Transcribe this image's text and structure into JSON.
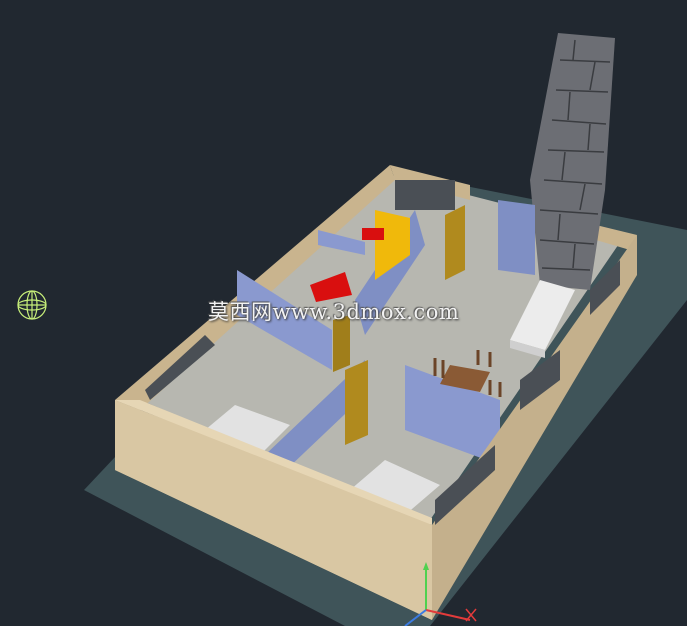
{
  "viewport": {
    "background": "#212830",
    "watermark": "莫西网www.3dmox.com"
  },
  "scene": {
    "subject": "3D house floor plan model",
    "colors": {
      "ground": "#3f5459",
      "exterior_wall": "#d2bf9a",
      "interior_wall": "#7f8fc4",
      "floor": "#b7b7b0",
      "door": "#b08a1e",
      "chimney": "#6c6e74",
      "fridge": "#f0b90b",
      "red_furniture": "#d90f0f"
    }
  },
  "icons": {
    "view_cube": "wireframe-sphere-icon",
    "axes": "ucs-axis-icon"
  }
}
